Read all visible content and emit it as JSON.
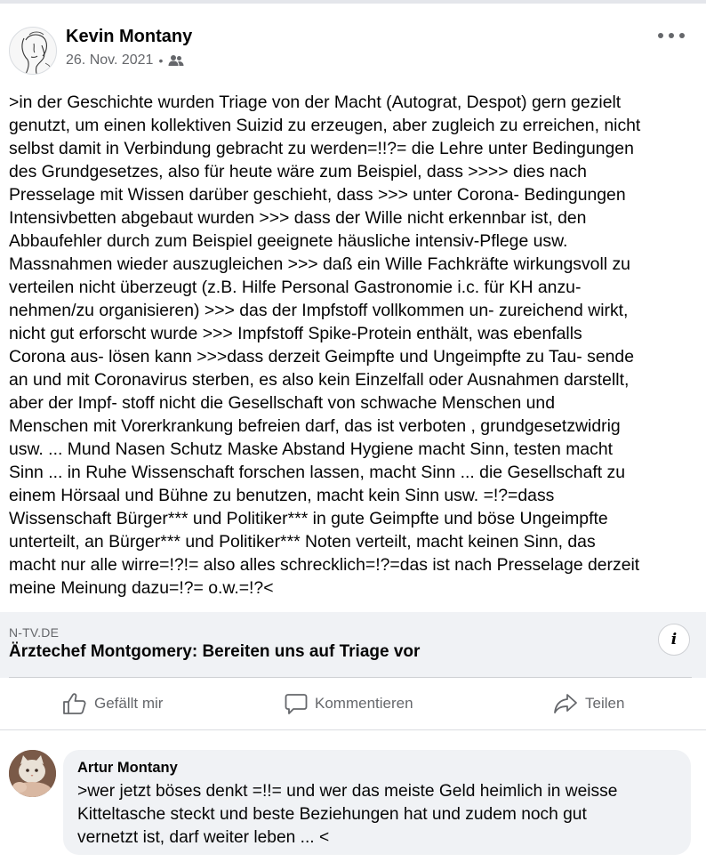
{
  "post": {
    "author": "Kevin Montany",
    "date": "26. Nov. 2021",
    "separator": "•",
    "audience_icon": "friends-icon",
    "more_icon": "more-options-icon",
    "text_lines": [
      ">in der Geschichte wurden Triage von der Macht (Autograt, Despot) gern gezielt",
      "genutzt, um einen kollektiven Suizid zu erzeugen, aber zugleich zu erreichen, nicht",
      "selbst damit in Verbindung  gebracht zu werden=!!?= die Lehre unter Bedingungen",
      "des Grundgesetzes, also für heute wäre zum Beispiel, dass  >>>>  dies nach",
      "Presselage mit Wissen darüber geschieht, dass >>> unter Corona- Bedingungen",
      "Intensivbetten abgebaut wurden >>> dass der Wille nicht erkennbar ist, den",
      "Abbaufehler durch zum Beispiel geeignete häusliche intensiv-Pflege usw.",
      "Massnahmen wieder auszugleichen >>>  daß ein Wille Fachkräfte wirkungsvoll zu",
      "verteilen nicht überzeugt (z.B. Hilfe Personal Gastronomie i.c. für KH anzu-",
      "nehmen/zu organisieren) >>> das der Impfstoff vollkommen un- zureichend wirkt,",
      "nicht gut erforscht wurde >>> Impfstoff Spike-Protein enthält, was ebenfalls",
      "Corona aus- lösen kann >>>dass derzeit Geimpfte und Ungeimpfte zu Tau- sende",
      "an und mit Coronavirus sterben, es also kein Einzelfall oder Ausnahmen darstellt,",
      "aber der Impf- stoff nicht die Gesellschaft von schwache Menschen und",
      "Menschen mit Vorerkrankung befreien darf, das ist verboten , grundgesetzwidrig",
      "usw. ... Mund Nasen Schutz Maske Abstand Hygiene macht Sinn, testen macht",
      "Sinn ... in Ruhe Wissenschaft forschen lassen, macht Sinn ... die Gesellschaft zu",
      "einem Hörsaal und Bühne zu benutzen, macht kein Sinn usw. =!?=dass",
      "Wissenschaft Bürger*** und Politiker*** in gute Geimpfte und böse Ungeimpfte",
      "unterteilt, an Bürger*** und Politiker*** Noten verteilt, macht keinen Sinn, das",
      "macht nur alle wirre=!?!= also alles schrecklich=!?=das ist nach Presselage derzeit",
      "meine Meinung dazu=!?= o.w.=!?<"
    ]
  },
  "link_preview": {
    "domain": "N-TV.DE",
    "title": "Ärztechef Montgomery: Bereiten uns auf Triage vor",
    "info_label": "i"
  },
  "actions": {
    "like": "Gefällt mir",
    "comment": "Kommentieren",
    "share": "Teilen"
  },
  "comment": {
    "author": "Artur Montany",
    "text_lines": [
      ">wer jetzt böses denkt =!!= und wer das meiste Geld heimlich in weisse",
      "Kitteltasche steckt und beste Beziehungen hat und zudem noch gut",
      "vernetzt ist, darf weiter leben ... <"
    ]
  },
  "colors": {
    "text": "#050505",
    "secondary": "#65676b",
    "card_bg": "#f0f2f5",
    "divider": "#ced0d4"
  }
}
